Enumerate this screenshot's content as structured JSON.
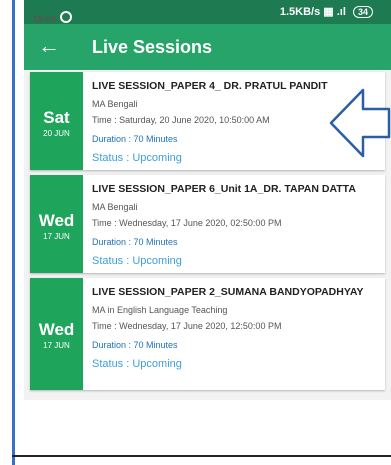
{
  "status_bar": {
    "time": "18:04",
    "network": "1.5KB/s",
    "battery": "34"
  },
  "app_bar": {
    "title": "Live Sessions"
  },
  "sessions": [
    {
      "day": "Sat",
      "date": "20 JUN",
      "title": "LIVE SESSION_PAPER 4_ DR. PRATUL PANDIT",
      "course": "MA Bengali",
      "time": "Time : Saturday, 20 June 2020, 10:50:00 AM",
      "duration": "Duration : 70 Minutes",
      "status": "Status : Upcoming"
    },
    {
      "day": "Wed",
      "date": "17 JUN",
      "title": "LIVE SESSION_PAPER 6_Unit 1A_DR. TAPAN DATTA",
      "course": "MA Bengali",
      "time": "Time : Wednesday, 17 June 2020, 02:50:00 PM",
      "duration": "Duration : 70 Minutes",
      "status": "Status : Upcoming"
    },
    {
      "day": "Wed",
      "date": "17 JUN",
      "title": "LIVE SESSION_PAPER 2_SUMANA BANDYOPADHYAY",
      "course": "MA in English Language Teaching",
      "time": "Time : Wednesday, 17 June 2020, 12:50:00 PM",
      "duration": "Duration : 70 Minutes",
      "status": "Status : Upcoming"
    }
  ],
  "colors": {
    "status_bar": "#1e7a50",
    "app_bar": "#27a469",
    "date_badge": "#1fa55b",
    "duration_text": "#1e72b8",
    "status_text": "#3e9fd8",
    "annotation_arrow": "#2a5fa8"
  },
  "icons": {
    "back": "arrow-left-icon",
    "annotation": "arrow-left-outline-icon"
  }
}
